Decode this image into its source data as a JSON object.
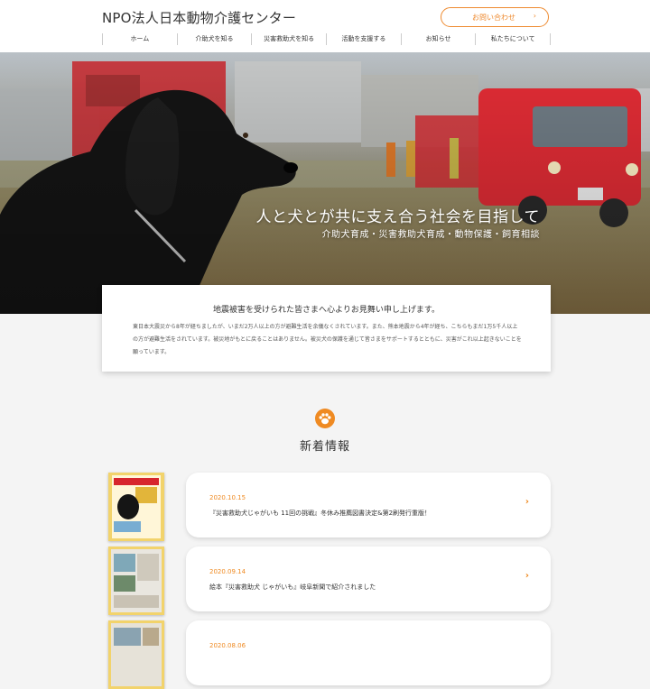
{
  "header": {
    "logo": "NPO法人日本動物介護センター",
    "contact_label": "お問い合わせ",
    "contact_icon": "chevron-right-icon",
    "accent_color": "#ee8a2f"
  },
  "nav": {
    "items": [
      "ホーム",
      "介助犬を知る",
      "災害救助犬を知る",
      "活動を支援する",
      "お知らせ",
      "私たちについて"
    ]
  },
  "hero": {
    "title": "人と犬とが共に支え合う社会を目指して",
    "subtitle": "介助犬育成・災害救助犬育成・動物保護・飼育相談"
  },
  "notice": {
    "title": "地震被害を受けられた皆さまへ心よりお見舞い申し上げます。",
    "body": "東日本大震災から8年が経ちましたが、いまだ2万人以上の方が避難生活を余儀なくされています。また、熊本地震から4年が経ち、こちらもまだ1万5千人以上の方が避難生活をされています。被災地がもとに戻ることはありません。被災犬の保護を通じて皆さまをサポートするとともに、災害がこれ以上起きないことを願っています。"
  },
  "news": {
    "heading": "新着情報",
    "icon": "paw-icon",
    "items": [
      {
        "date": "2020.10.15",
        "title": "『災害救助犬じゃがいも 11回の挑戦』冬休み推薦図書決定&第2刷発行重版！"
      },
      {
        "date": "2020.09.14",
        "title": "絵本『災害救助犬 じゃがいも』岐阜新聞で紹介されました"
      },
      {
        "date": "2020.08.06",
        "title": ""
      }
    ]
  }
}
